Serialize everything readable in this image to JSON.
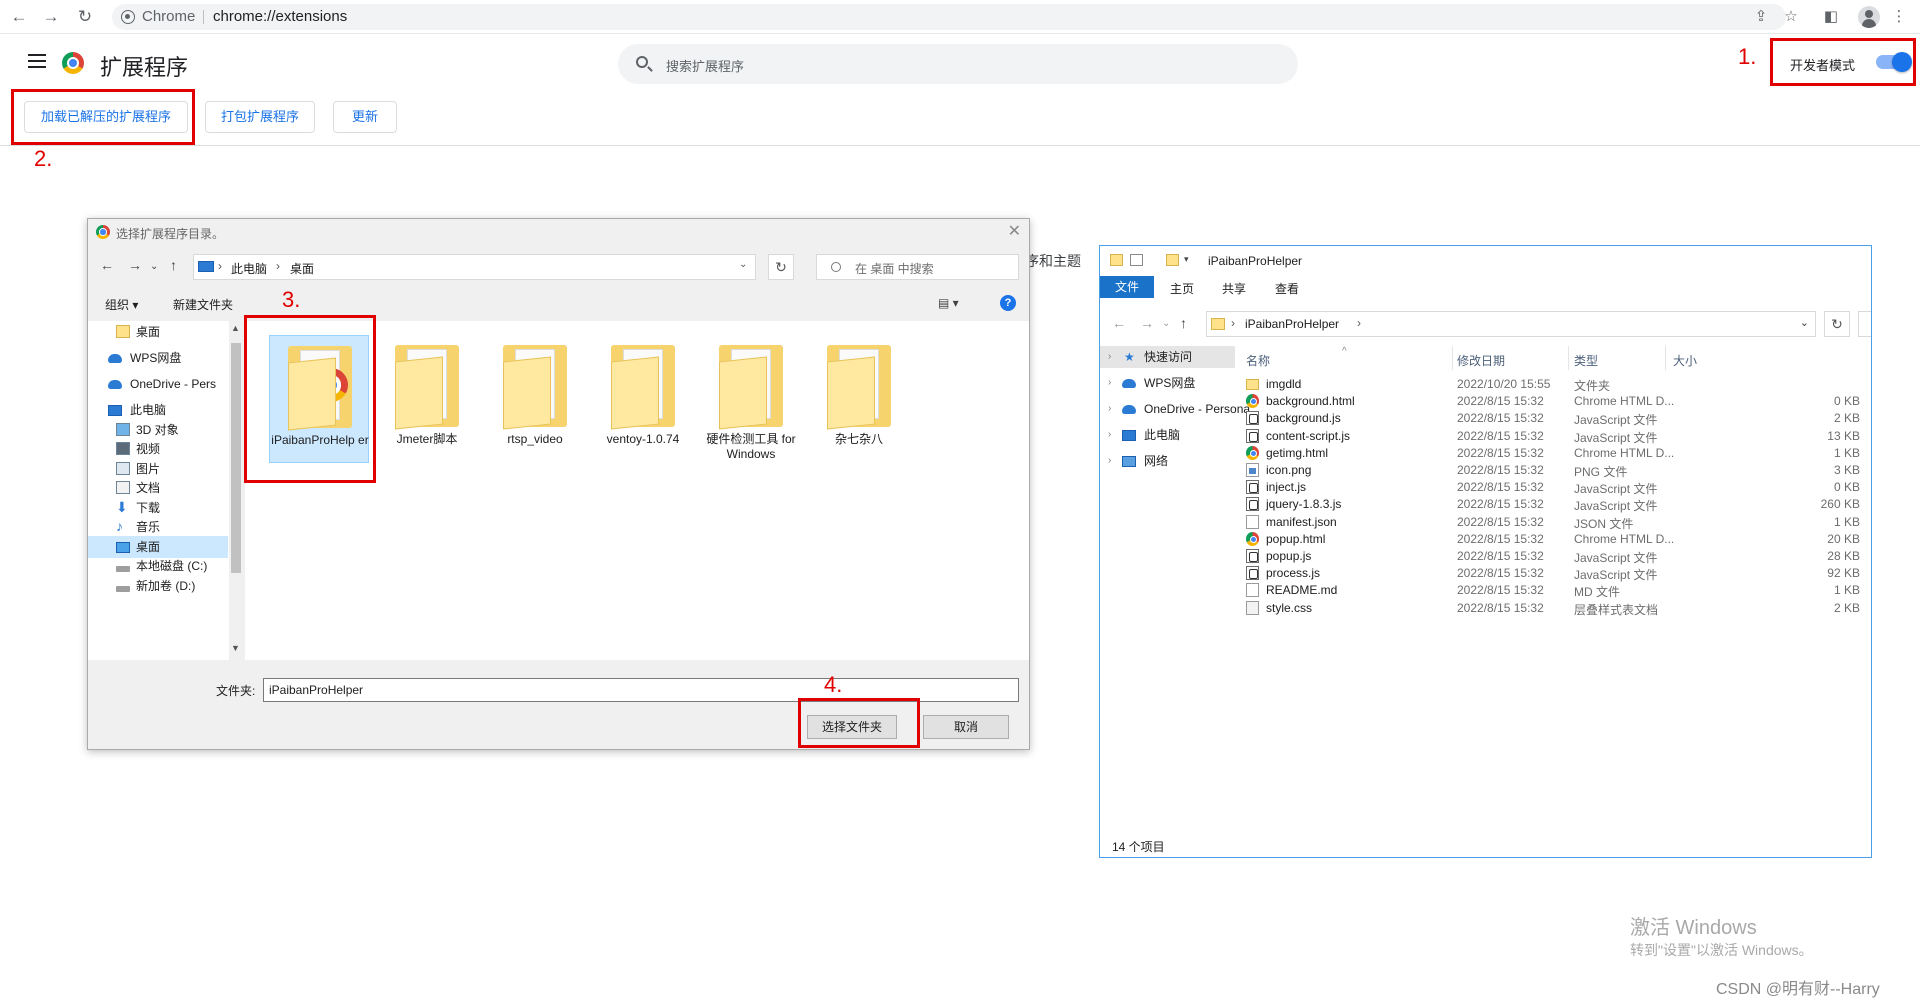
{
  "browser": {
    "site_name": "Chrome",
    "url": "chrome://extensions"
  },
  "extensions_page": {
    "title": "扩展程序",
    "search_placeholder": "搜索扩展程序",
    "dev_mode_label": "开发者模式",
    "dev_mode_on": true,
    "buttons": {
      "load_unpacked": "加载已解压的扩展程序",
      "pack": "打包扩展程序",
      "update": "更新"
    },
    "partial_background_text": "序和主题"
  },
  "annotations": {
    "step1": "1.",
    "step2": "2.",
    "step3": "3.",
    "step4": "4.",
    "highlight_color": "#e00000"
  },
  "folder_dialog": {
    "title": "选择扩展程序目录。",
    "breadcrumb": [
      "此电脑",
      "桌面"
    ],
    "search_placeholder": "在 桌面 中搜索",
    "organize": "组织 ▾",
    "new_folder": "新建文件夹",
    "tree": [
      {
        "label": "桌面",
        "icon": "folder-icon"
      },
      {
        "label": "WPS网盘",
        "icon": "cloud-icon"
      },
      {
        "label": "OneDrive - Pers",
        "icon": "onedrive-icon"
      },
      {
        "label": "此电脑",
        "icon": "computer-icon"
      },
      {
        "label": "3D 对象",
        "icon": "3d-objects-icon"
      },
      {
        "label": "视频",
        "icon": "video-icon"
      },
      {
        "label": "图片",
        "icon": "pictures-icon"
      },
      {
        "label": "文档",
        "icon": "documents-icon"
      },
      {
        "label": "下载",
        "icon": "download-icon"
      },
      {
        "label": "音乐",
        "icon": "music-icon"
      },
      {
        "label": "桌面",
        "icon": "desktop-icon",
        "selected": true
      },
      {
        "label": "本地磁盘 (C:)",
        "icon": "drive-icon"
      },
      {
        "label": "新加卷 (D:)",
        "icon": "drive-icon"
      }
    ],
    "folders": [
      {
        "label": "iPaibanProHelp er",
        "selected": true
      },
      {
        "label": "Jmeter脚本"
      },
      {
        "label": "rtsp_video"
      },
      {
        "label": "ventoy-1.0.74"
      },
      {
        "label": "硬件检测工具 for Windows"
      },
      {
        "label": "杂七杂八"
      }
    ],
    "filename_label": "文件夹:",
    "filename_value": "iPaibanProHelper",
    "select_button": "选择文件夹",
    "cancel_button": "取消"
  },
  "explorer": {
    "title": "iPaibanProHelper",
    "ribbon_tabs": [
      "文件",
      "主页",
      "共享",
      "查看"
    ],
    "address_crumb": "iPaibanProHelper",
    "tree": [
      {
        "label": "快速访问",
        "selected": true
      },
      {
        "label": "WPS网盘"
      },
      {
        "label": "OneDrive - Persona"
      },
      {
        "label": "此电脑"
      },
      {
        "label": "网络"
      }
    ],
    "columns": [
      "名称",
      "修改日期",
      "类型",
      "大小"
    ],
    "files": [
      {
        "name": "imgdld",
        "date": "2022/10/20 15:55",
        "type": "文件夹",
        "size": "",
        "icon": "folder"
      },
      {
        "name": "background.html",
        "date": "2022/8/15 15:32",
        "type": "Chrome HTML D...",
        "size": "0 KB",
        "icon": "chrome"
      },
      {
        "name": "background.js",
        "date": "2022/8/15 15:32",
        "type": "JavaScript 文件",
        "size": "2 KB",
        "icon": "js"
      },
      {
        "name": "content-script.js",
        "date": "2022/8/15 15:32",
        "type": "JavaScript 文件",
        "size": "13 KB",
        "icon": "js"
      },
      {
        "name": "getimg.html",
        "date": "2022/8/15 15:32",
        "type": "Chrome HTML D...",
        "size": "1 KB",
        "icon": "chrome"
      },
      {
        "name": "icon.png",
        "date": "2022/8/15 15:32",
        "type": "PNG 文件",
        "size": "3 KB",
        "icon": "png"
      },
      {
        "name": "inject.js",
        "date": "2022/8/15 15:32",
        "type": "JavaScript 文件",
        "size": "0 KB",
        "icon": "js"
      },
      {
        "name": "jquery-1.8.3.js",
        "date": "2022/8/15 15:32",
        "type": "JavaScript 文件",
        "size": "260 KB",
        "icon": "js"
      },
      {
        "name": "manifest.json",
        "date": "2022/8/15 15:32",
        "type": "JSON 文件",
        "size": "1 KB",
        "icon": "doc"
      },
      {
        "name": "popup.html",
        "date": "2022/8/15 15:32",
        "type": "Chrome HTML D...",
        "size": "20 KB",
        "icon": "chrome"
      },
      {
        "name": "popup.js",
        "date": "2022/8/15 15:32",
        "type": "JavaScript 文件",
        "size": "28 KB",
        "icon": "js"
      },
      {
        "name": "process.js",
        "date": "2022/8/15 15:32",
        "type": "JavaScript 文件",
        "size": "92 KB",
        "icon": "js"
      },
      {
        "name": "README.md",
        "date": "2022/8/15 15:32",
        "type": "MD 文件",
        "size": "1 KB",
        "icon": "doc"
      },
      {
        "name": "style.css",
        "date": "2022/8/15 15:32",
        "type": "层叠样式表文档",
        "size": "2 KB",
        "icon": "css"
      }
    ],
    "status": "14 个项目"
  },
  "watermark": {
    "line1": "激活 Windows",
    "line2": "转到\"设置\"以激活 Windows。"
  },
  "csdn_credit": "CSDN @明有财--Harry"
}
